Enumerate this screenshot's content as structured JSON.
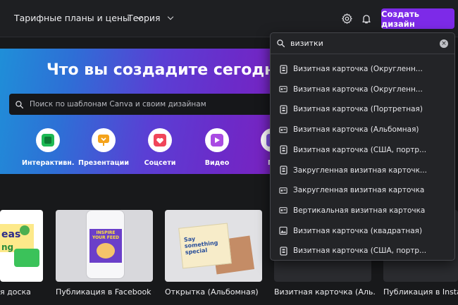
{
  "topbar": {
    "nav_plans": "Тарифные планы и цены",
    "nav_theory": "Теория",
    "create_label": "Создать дизайн"
  },
  "hero": {
    "title": "Что вы создадите сегодня?",
    "search_placeholder": "Поиск по шаблонам Canva и своим дизайнам",
    "categories": [
      {
        "label": "Интерактивн...",
        "icon": "interactive-icon",
        "color": "#1db954"
      },
      {
        "label": "Презентации",
        "icon": "presentation-icon",
        "color": "#f4a31b"
      },
      {
        "label": "Соцсети",
        "icon": "heart-icon",
        "color": "#f0455a"
      },
      {
        "label": "Видео",
        "icon": "video-icon",
        "color": "#a94be3"
      },
      {
        "label": "Пе",
        "icon": "print-icon",
        "color": "#7d52e0"
      }
    ]
  },
  "templates": [
    {
      "label": "я доска"
    },
    {
      "label": "Публикация в Facebook (..."
    },
    {
      "label": "Открытка (Альбомная)"
    },
    {
      "label": "Визитная карточка (Аль..."
    },
    {
      "label": "Публикация в Instag"
    }
  ],
  "card_texts": {
    "ideas": "eas",
    "ideas2": "ng",
    "inspire": "INSPIRE YOUR FEED",
    "say": "Say something special"
  },
  "dropdown": {
    "query": "визитки",
    "results": [
      {
        "label": "Визитная карточка (Округленн...",
        "icon": "card-portrait-icon"
      },
      {
        "label": "Визитная карточка (Округленн...",
        "icon": "card-landscape-icon"
      },
      {
        "label": "Визитная карточка (Портретная)",
        "icon": "card-portrait-icon"
      },
      {
        "label": "Визитная карточка (Альбомная)",
        "icon": "card-landscape-icon"
      },
      {
        "label": "Визитная карточка (США, портр...",
        "icon": "card-portrait-icon"
      },
      {
        "label": "Закругленная визитная карточк...",
        "icon": "card-portrait-icon"
      },
      {
        "label": "Закругленная визитная карточка",
        "icon": "card-landscape-icon"
      },
      {
        "label": "Вертикальная визитная карточка",
        "icon": "card-landscape-icon"
      },
      {
        "label": "Визитная карточка (квадратная)",
        "icon": "image-icon"
      },
      {
        "label": "Визитная карточка (США, портр...",
        "icon": "card-portrait-icon"
      }
    ]
  },
  "colors": {
    "accent": "#7d2ae8",
    "background": "#18191b"
  }
}
